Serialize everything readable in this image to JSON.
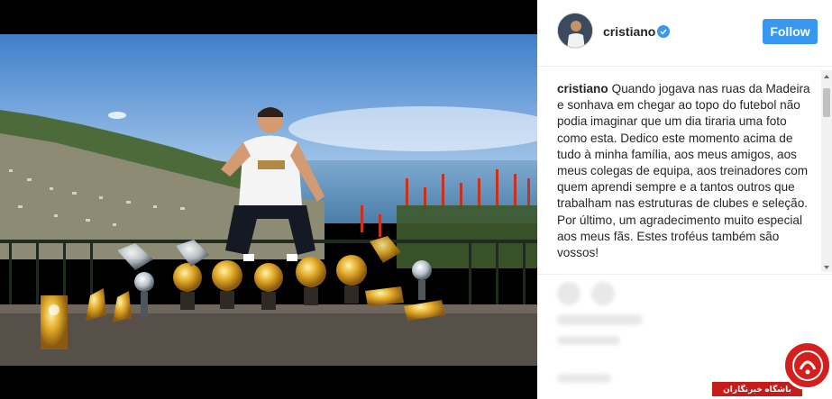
{
  "post": {
    "username": "cristiano",
    "follow_label": "Follow",
    "caption_user": "cristiano",
    "caption_text": "Quando jogava nas ruas da Madeira e sonhava em chegar ao topo do futebol não podia imaginar que um dia tiraria uma foto como esta. Dedico este momento acima de tudo à minha família, aos meus amigos, aos meus colegas de equipa, aos treinadores com quem aprendi sempre e a tantos outros que trabalham nas estruturas de clubes e seleção. Por último, um agradecimento muito especial aos meus fãs. Estes troféus também são vossos!"
  },
  "watermark": {
    "label": "باشگاه خبرنگاران"
  },
  "colors": {
    "follow_button": "#3897f0",
    "verified_badge": "#3897f0",
    "watermark_red": "#d41f1f"
  },
  "icons": {
    "verified": "verified-badge-icon",
    "like": "heart-icon",
    "comment": "comment-icon"
  }
}
